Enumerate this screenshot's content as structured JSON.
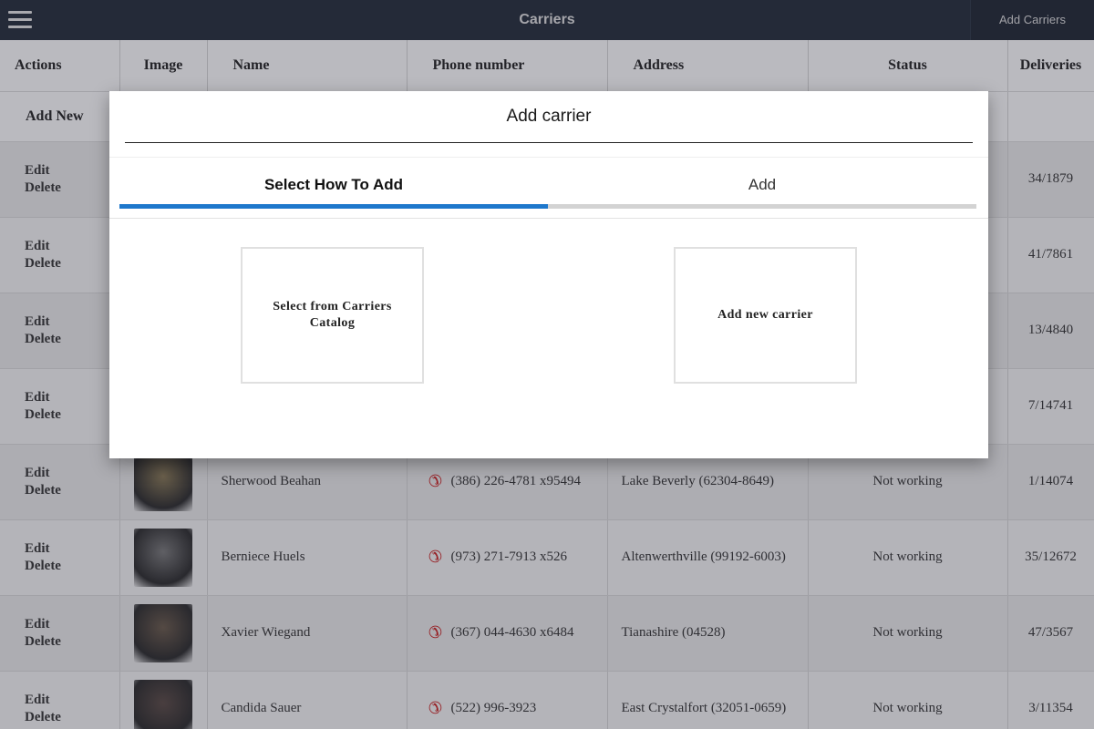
{
  "header": {
    "title": "Carriers",
    "add_button": "Add Carriers"
  },
  "table": {
    "columns": [
      "Actions",
      "Image",
      "Name",
      "Phone number",
      "Address",
      "Status",
      "Deliveries"
    ],
    "add_new": "Add New",
    "edit_label": "Edit",
    "delete_label": "Delete",
    "rows": [
      {
        "name": "",
        "phone": "",
        "address": "",
        "status": "",
        "deliveries": "34/1879"
      },
      {
        "name": "",
        "phone": "",
        "address": "",
        "status": "",
        "deliveries": "41/7861"
      },
      {
        "name": "",
        "phone": "",
        "address": "",
        "status": "",
        "deliveries": "13/4840"
      },
      {
        "name": "",
        "phone": "",
        "address": "",
        "status": "",
        "deliveries": "7/14741"
      },
      {
        "name": "Sherwood Beahan",
        "phone": "(386) 226-4781 x95494",
        "address": "Lake Beverly (62304-8649)",
        "status": "Not working",
        "deliveries": "1/14074"
      },
      {
        "name": "Berniece Huels",
        "phone": "(973) 271-7913 x526",
        "address": "Altenwerthville (99192-6003)",
        "status": "Not working",
        "deliveries": "35/12672"
      },
      {
        "name": "Xavier Wiegand",
        "phone": "(367) 044-4630 x6484",
        "address": "Tianashire (04528)",
        "status": "Not working",
        "deliveries": "47/3567"
      },
      {
        "name": "Candida Sauer",
        "phone": "(522) 996-3923",
        "address": "East Crystalfort (32051-0659)",
        "status": "Not working",
        "deliveries": "3/11354"
      }
    ]
  },
  "modal": {
    "title": "Add carrier",
    "tabs": [
      {
        "label": "Select How To Add",
        "active": true
      },
      {
        "label": "Add",
        "active": false
      }
    ],
    "progress": 0.5,
    "options": [
      {
        "label": "Select from Carriers Catalog"
      },
      {
        "label": "Add new carrier"
      }
    ]
  },
  "colors": {
    "topbar": "#222b38",
    "accent": "#1e78cc",
    "status_not_working": "#d02828",
    "link": "#2a6ab8"
  },
  "icons": {
    "menu": "hamburger-icon",
    "phone": "phone-icon"
  }
}
